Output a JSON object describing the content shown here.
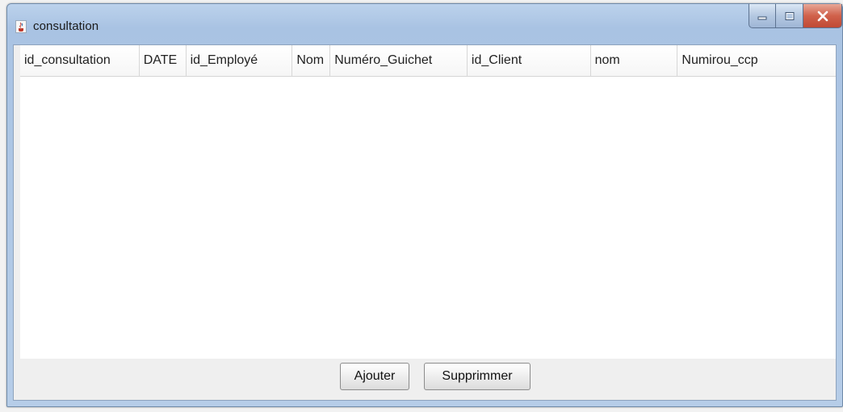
{
  "window": {
    "title": "consultation",
    "icon": "java-cup-icon",
    "controls": [
      "minimize-icon",
      "maximize-icon",
      "close-icon"
    ]
  },
  "table": {
    "columns": [
      "id_consultation",
      "DATE",
      "id_Employé",
      "Nom",
      "Numéro_Guichet",
      "id_Client",
      "nom",
      "Numirou_ccp"
    ],
    "rows": []
  },
  "buttons": {
    "add_label": "Ajouter",
    "delete_label": "Supprimmer"
  },
  "colors": {
    "titlebar": "#b6cde8",
    "close": "#c04a35",
    "table_bg": "#ffffff"
  }
}
